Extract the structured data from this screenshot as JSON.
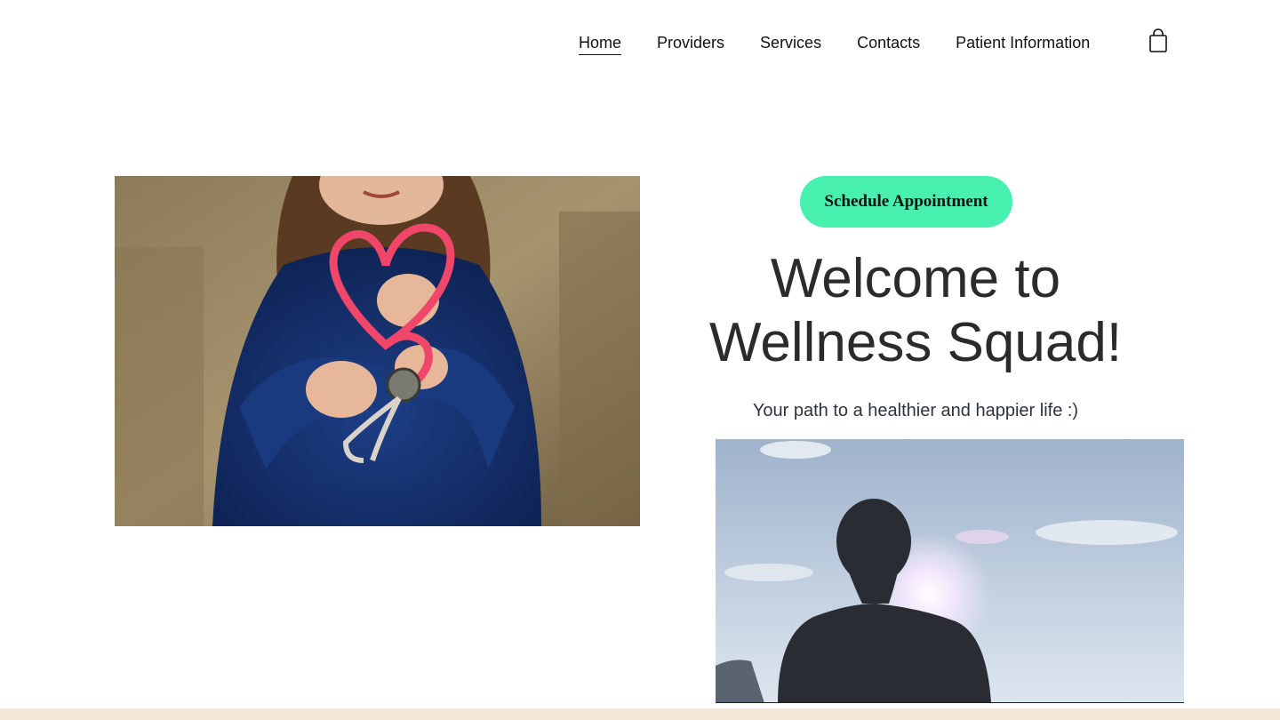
{
  "nav": {
    "items": [
      {
        "label": "Home",
        "active": true
      },
      {
        "label": "Providers",
        "active": false
      },
      {
        "label": "Services",
        "active": false
      },
      {
        "label": "Contacts",
        "active": false
      },
      {
        "label": "Patient Information",
        "active": false
      }
    ],
    "cart_icon": "shopping-bag-icon"
  },
  "hero": {
    "cta_label": "Schedule Appointment",
    "title_line1": "Welcome to",
    "title_line2": "Wellness Squad!",
    "subtitle": "Your path to a healthier and happier life :)"
  },
  "colors": {
    "accent": "#48f0b0",
    "footer": "#f2e6d6",
    "text": "#2b2b2b"
  }
}
